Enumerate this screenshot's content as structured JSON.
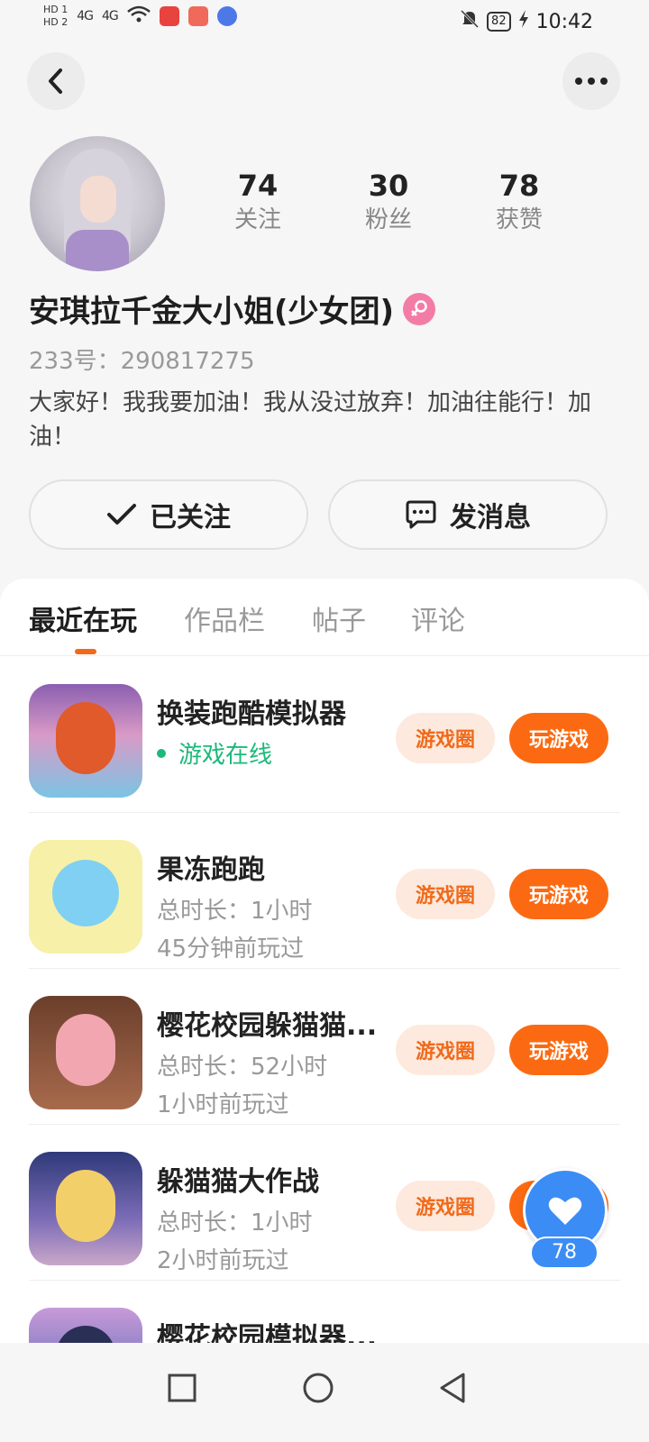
{
  "status_bar": {
    "hd1": "HD 1",
    "hd2": "HD 2",
    "signal1": "4G",
    "signal2": "4G",
    "battery": "82",
    "time": "10:42"
  },
  "profile": {
    "stats": [
      {
        "num": "74",
        "label": "关注"
      },
      {
        "num": "30",
        "label": "粉丝"
      },
      {
        "num": "78",
        "label": "获赞"
      }
    ],
    "nickname": "安琪拉千金大小姐(少女团)",
    "uid": "233号：290817275",
    "bio": "大家好！我我要加油！我从没过放弃！加油往能行！加油！",
    "follow_label": "已关注",
    "message_label": "发消息"
  },
  "tabs": [
    "最近在玩",
    "作品栏",
    "帖子",
    "评论"
  ],
  "games": [
    {
      "name": "换装跑酷模拟器",
      "line1": "游戏在线",
      "line2": "",
      "circle": "游戏圈",
      "play": "玩游戏"
    },
    {
      "name": "果冻跑跑",
      "line1": "总时长：1小时",
      "line2": "45分钟前玩过",
      "circle": "游戏圈",
      "play": "玩游戏"
    },
    {
      "name": "樱花校园躲猫猫...",
      "line1": "总时长：52小时",
      "line2": "1小时前玩过",
      "circle": "游戏圈",
      "play": "玩游戏"
    },
    {
      "name": "躲猫猫大作战",
      "line1": "总时长：1小时",
      "line2": "2小时前玩过",
      "circle": "游戏圈",
      "play": "玩游戏"
    },
    {
      "name": "樱花校园模拟器...",
      "line1": "",
      "line2": "",
      "circle": "",
      "play": ""
    }
  ],
  "like_fab": {
    "count": "78"
  },
  "colors": {
    "accent": "#fb6a12",
    "online": "#1cb97a",
    "like": "#3b8cf5",
    "female": "#f37ca6"
  }
}
